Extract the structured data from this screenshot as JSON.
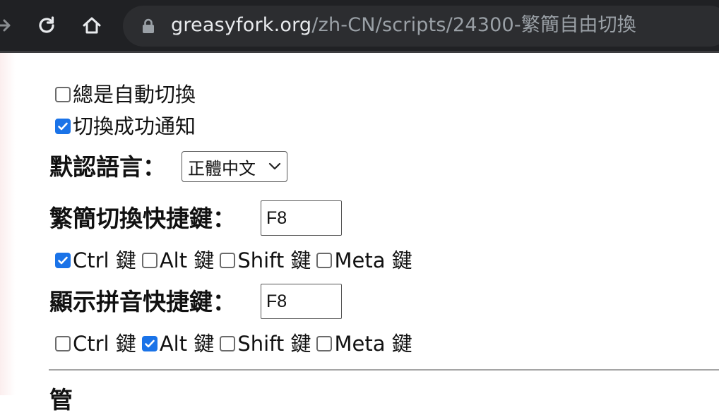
{
  "browser": {
    "url_host": "greasyfork.org",
    "url_path": "/zh-CN/scripts/24300-繁簡自由切換"
  },
  "options": {
    "always_switch": {
      "label": "總是自動切換",
      "checked": false
    },
    "notify_success": {
      "label": "切換成功通知",
      "checked": true
    }
  },
  "language": {
    "label": "默認語言：",
    "selected": "正體中文"
  },
  "switch_hotkey": {
    "label": "繁簡切換快捷鍵：",
    "key": "F8",
    "modifiers": [
      {
        "label": "Ctrl 鍵",
        "checked": true
      },
      {
        "label": "Alt 鍵",
        "checked": false
      },
      {
        "label": "Shift 鍵",
        "checked": false
      },
      {
        "label": "Meta 鍵",
        "checked": false
      }
    ]
  },
  "pinyin_hotkey": {
    "label": "顯示拼音快捷鍵：",
    "key": "F8",
    "modifiers": [
      {
        "label": "Ctrl 鍵",
        "checked": false
      },
      {
        "label": "Alt 鍵",
        "checked": true
      },
      {
        "label": "Shift 鍵",
        "checked": false
      },
      {
        "label": "Meta 鍵",
        "checked": false
      }
    ]
  },
  "next_section": {
    "partial_text": "管"
  }
}
